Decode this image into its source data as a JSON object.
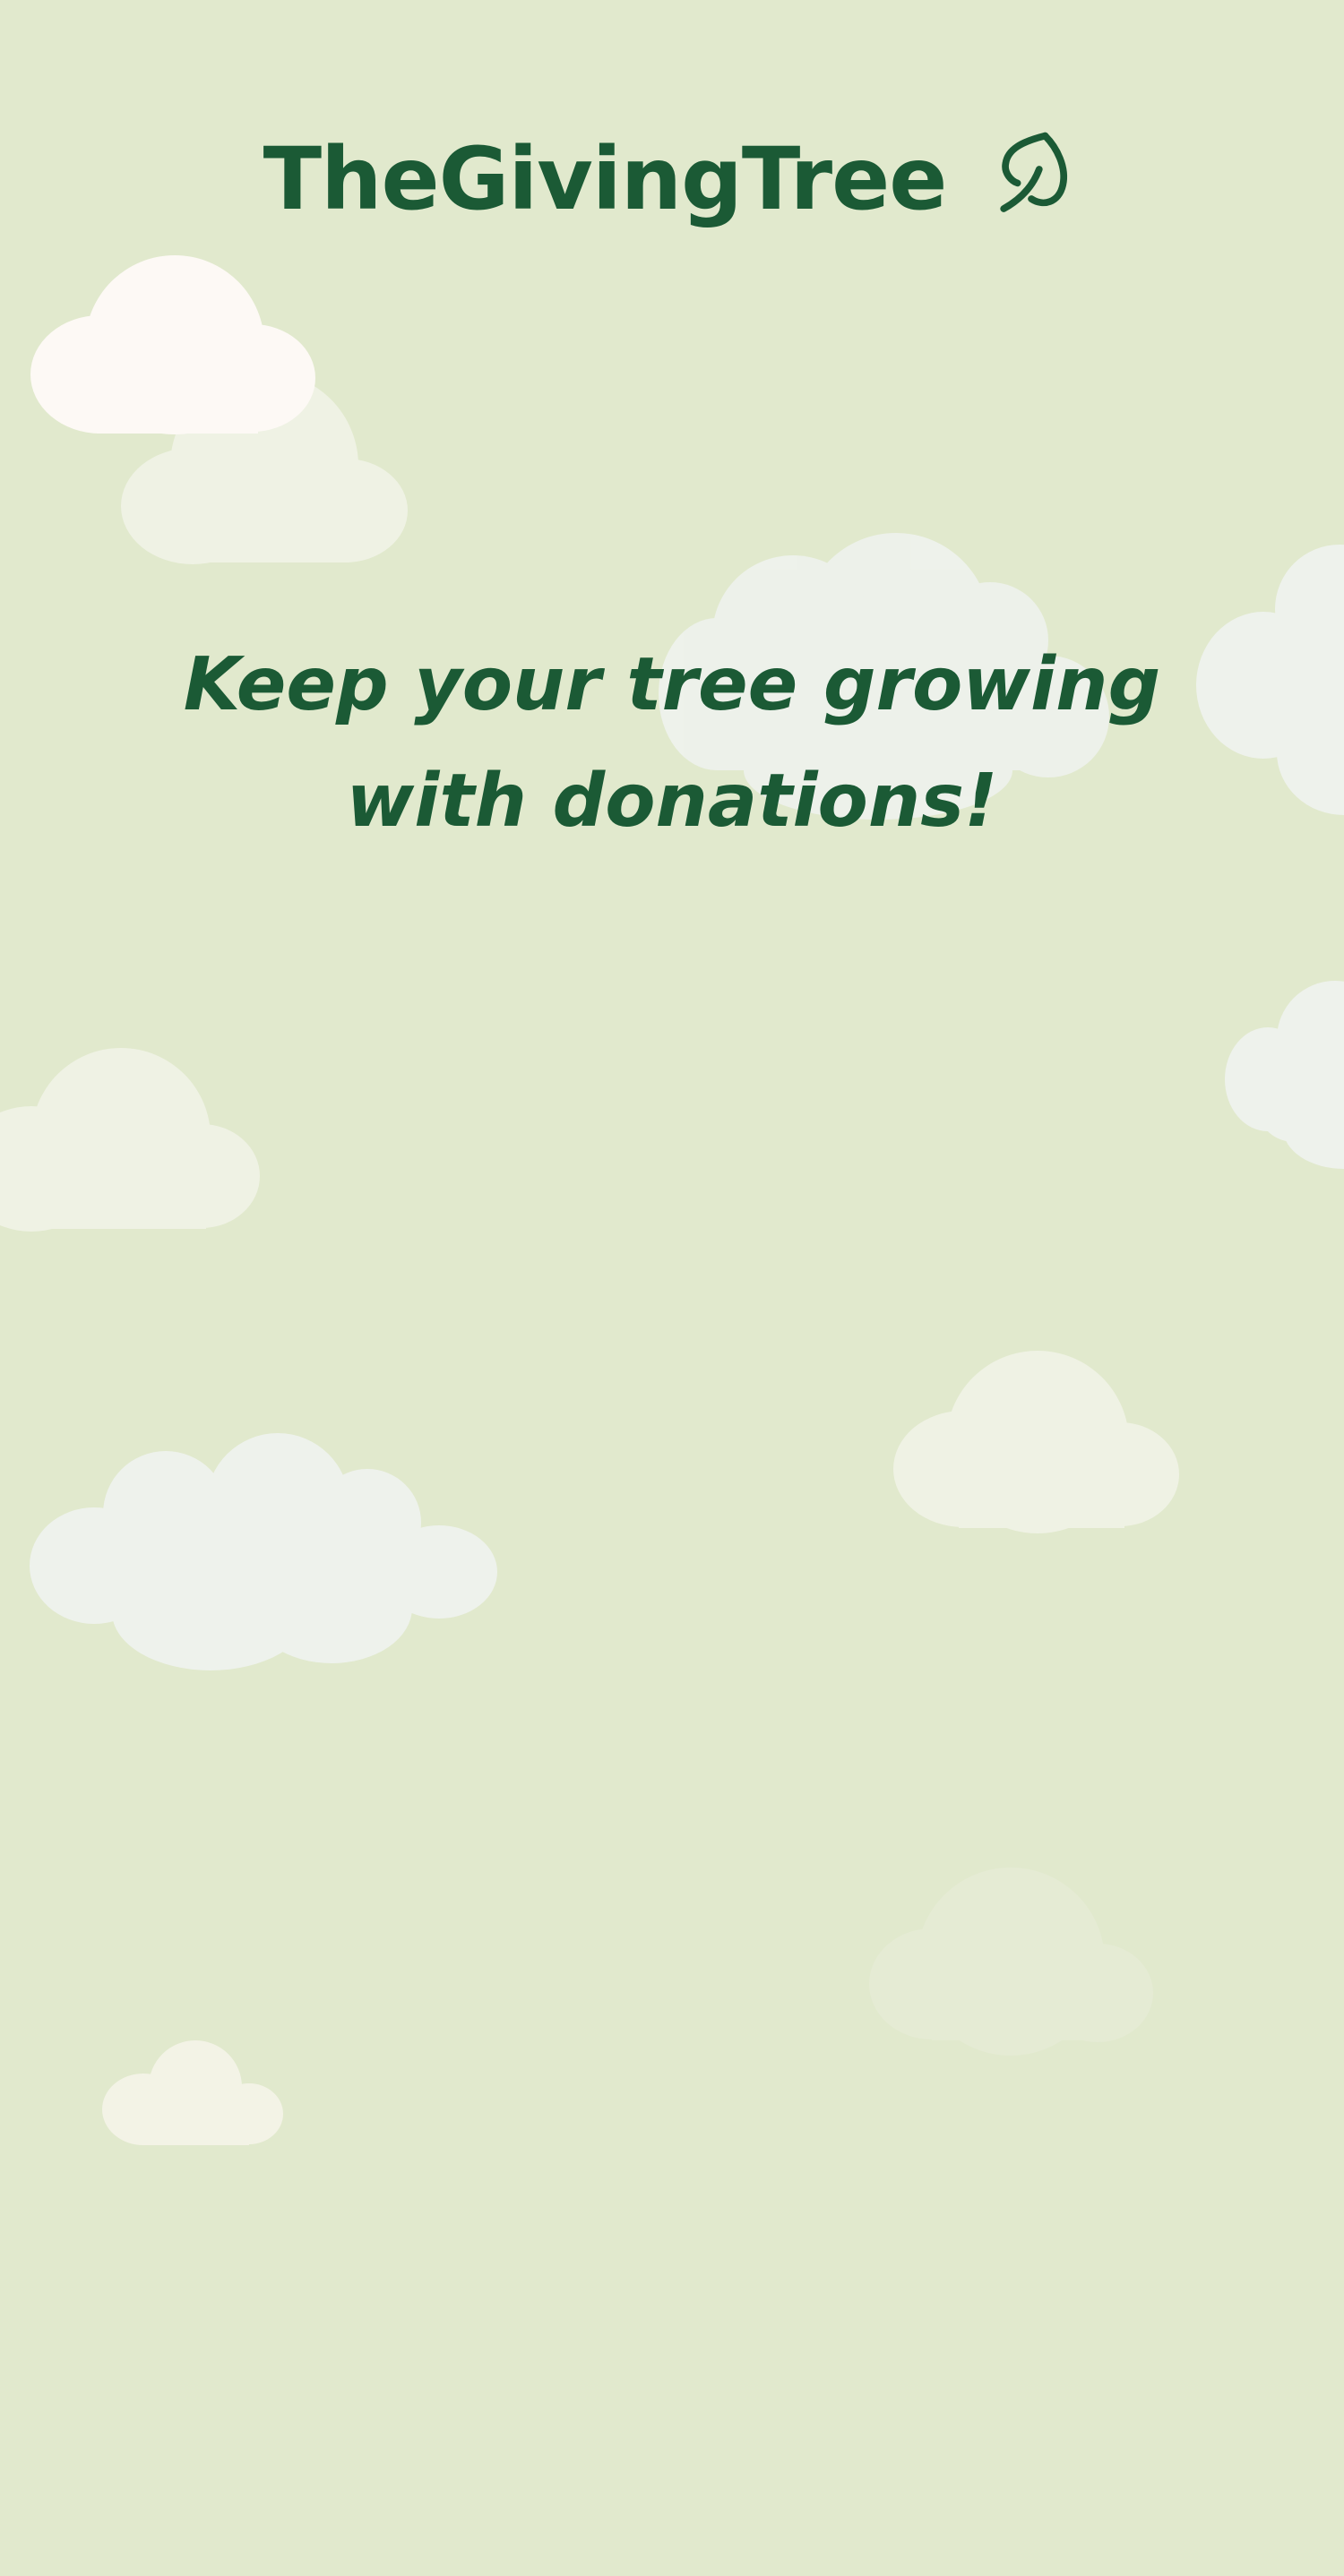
{
  "brand": {
    "name": "TheGivingTree",
    "icon": "leaf-icon"
  },
  "hero": {
    "line1": "Keep your tree growing",
    "line2": "with donations!"
  },
  "colors": {
    "background": "#e1e9cd",
    "brand_green": "#1b5a35",
    "cloud_white": "#fdf9f5",
    "cloud_pale": "#eef2ec",
    "cloud_cream": "#f0f2e4"
  }
}
